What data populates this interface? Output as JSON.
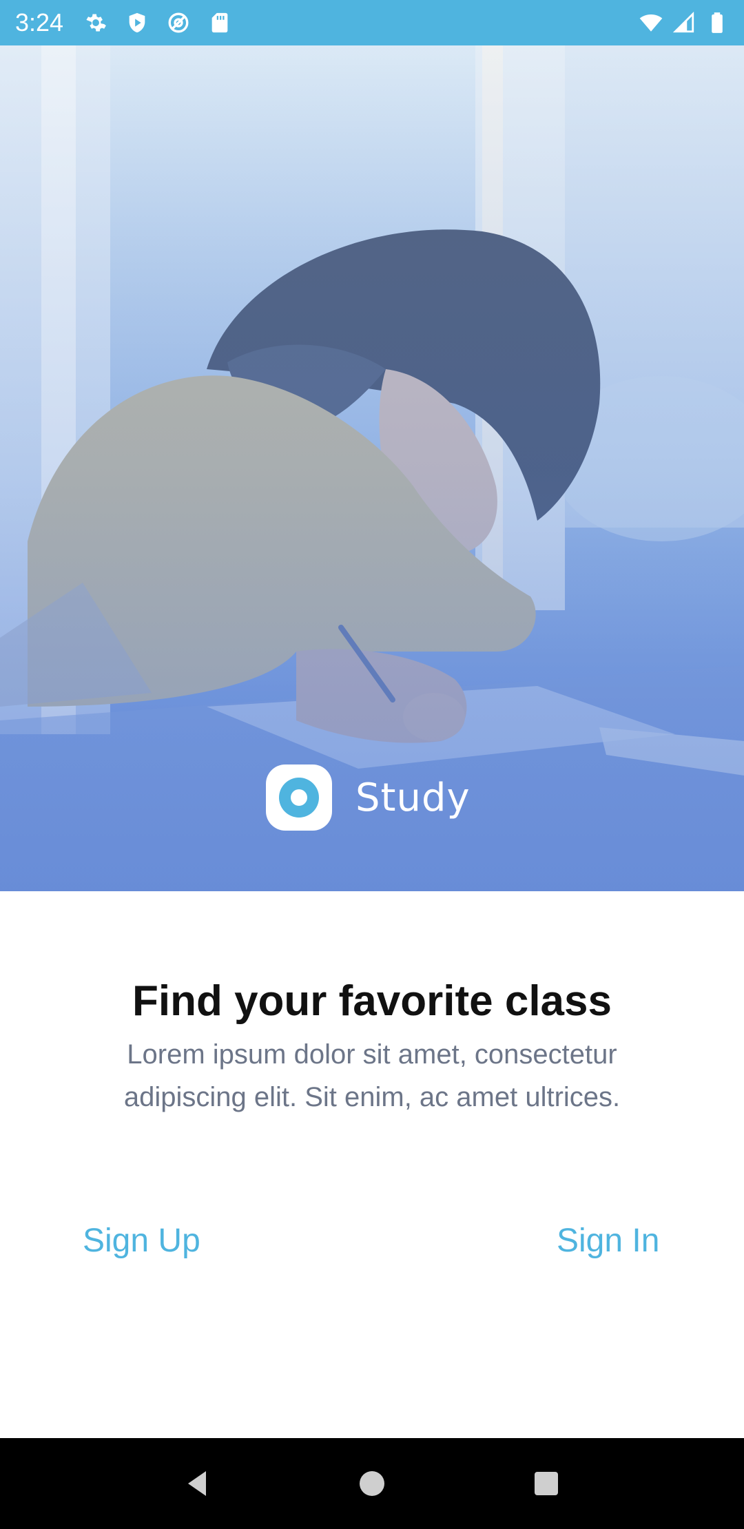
{
  "status_bar": {
    "time": "3:24",
    "left_icons": [
      "gear-icon",
      "shield-icon",
      "at-sign-icon",
      "sd-card-icon"
    ],
    "right_icons": [
      "wifi-icon",
      "signal-icon",
      "battery-icon"
    ],
    "background": "#4fb4df"
  },
  "hero": {
    "brand_name": "Study",
    "logo_icon": "study-logo-icon",
    "accent": "#4fb4df"
  },
  "content": {
    "headline": "Find your favorite class",
    "description": "Lorem ipsum dolor sit amet, consectetur adipiscing elit. Sit enim, ac amet ultrices.",
    "sign_up_label": "Sign Up",
    "sign_in_label": "Sign In",
    "link_color": "#4fb4df"
  },
  "nav_bar": {
    "buttons": [
      "back-icon",
      "home-icon",
      "recents-icon"
    ]
  }
}
